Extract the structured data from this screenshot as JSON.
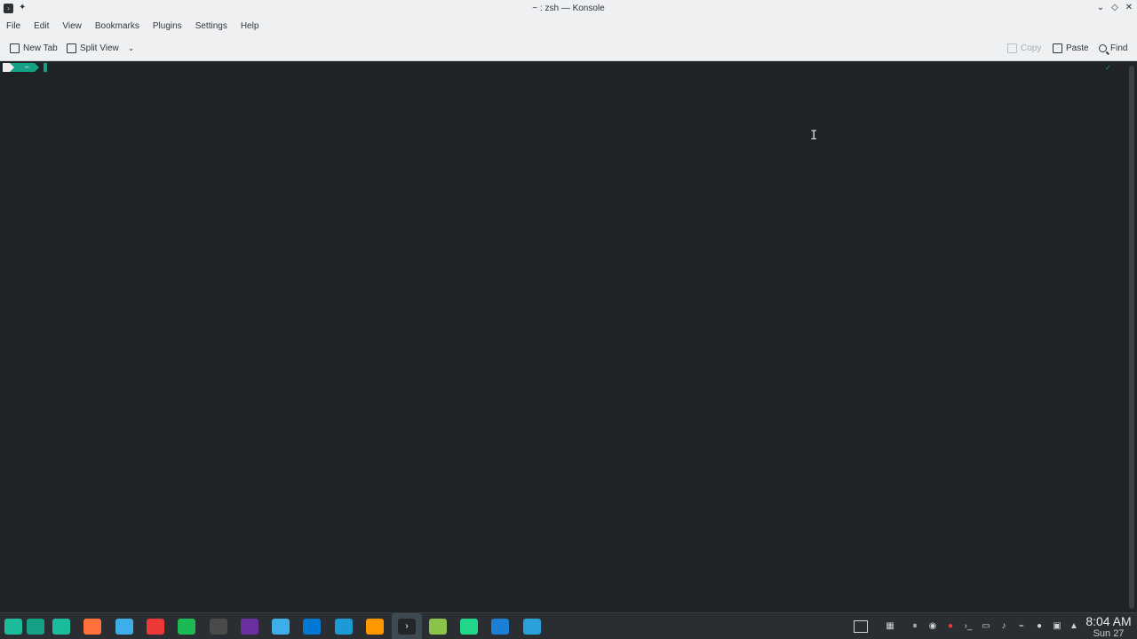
{
  "window": {
    "title": "~ : zsh — Konsole"
  },
  "menu": {
    "items": [
      "File",
      "Edit",
      "View",
      "Bookmarks",
      "Plugins",
      "Settings",
      "Help"
    ]
  },
  "toolbar": {
    "new_tab": "New Tab",
    "split_view": "Split View",
    "copy": "Copy",
    "paste": "Paste",
    "find": "Find"
  },
  "terminal": {
    "prompt_user_glyph": "",
    "prompt_dir": "~",
    "right_prompt": "✓"
  },
  "taskbar": {
    "apps": [
      {
        "name": "app-launcher-icon",
        "color": "#1abc9c"
      },
      {
        "name": "pager-icon",
        "color": "#16a085"
      },
      {
        "name": "file-manager-icon",
        "color": "#1abc9c"
      },
      {
        "name": "firefox-icon",
        "color": "#ff7139"
      },
      {
        "name": "browser-icon",
        "color": "#3daee9"
      },
      {
        "name": "vivaldi-icon",
        "color": "#ef3939"
      },
      {
        "name": "spotify-icon",
        "color": "#1db954"
      },
      {
        "name": "chromium-icon",
        "color": "#4a4a4a"
      },
      {
        "name": "media-icon",
        "color": "#6b2fa0"
      },
      {
        "name": "text-editor-icon",
        "color": "#3daee9"
      },
      {
        "name": "vscode-icon",
        "color": "#0078d4"
      },
      {
        "name": "steam-icon",
        "color": "#1b9ad6"
      },
      {
        "name": "sublime-icon",
        "color": "#ff9800"
      },
      {
        "name": "konsole-icon",
        "color": "#232629"
      },
      {
        "name": "package-icon",
        "color": "#8bc34a"
      },
      {
        "name": "pycharm-icon",
        "color": "#21d789"
      },
      {
        "name": "headphones-icon",
        "color": "#1b7fd6"
      },
      {
        "name": "telegram-icon",
        "color": "#2aa1da"
      }
    ],
    "clock_time": "8:04 AM",
    "clock_date": "Sun 27"
  }
}
